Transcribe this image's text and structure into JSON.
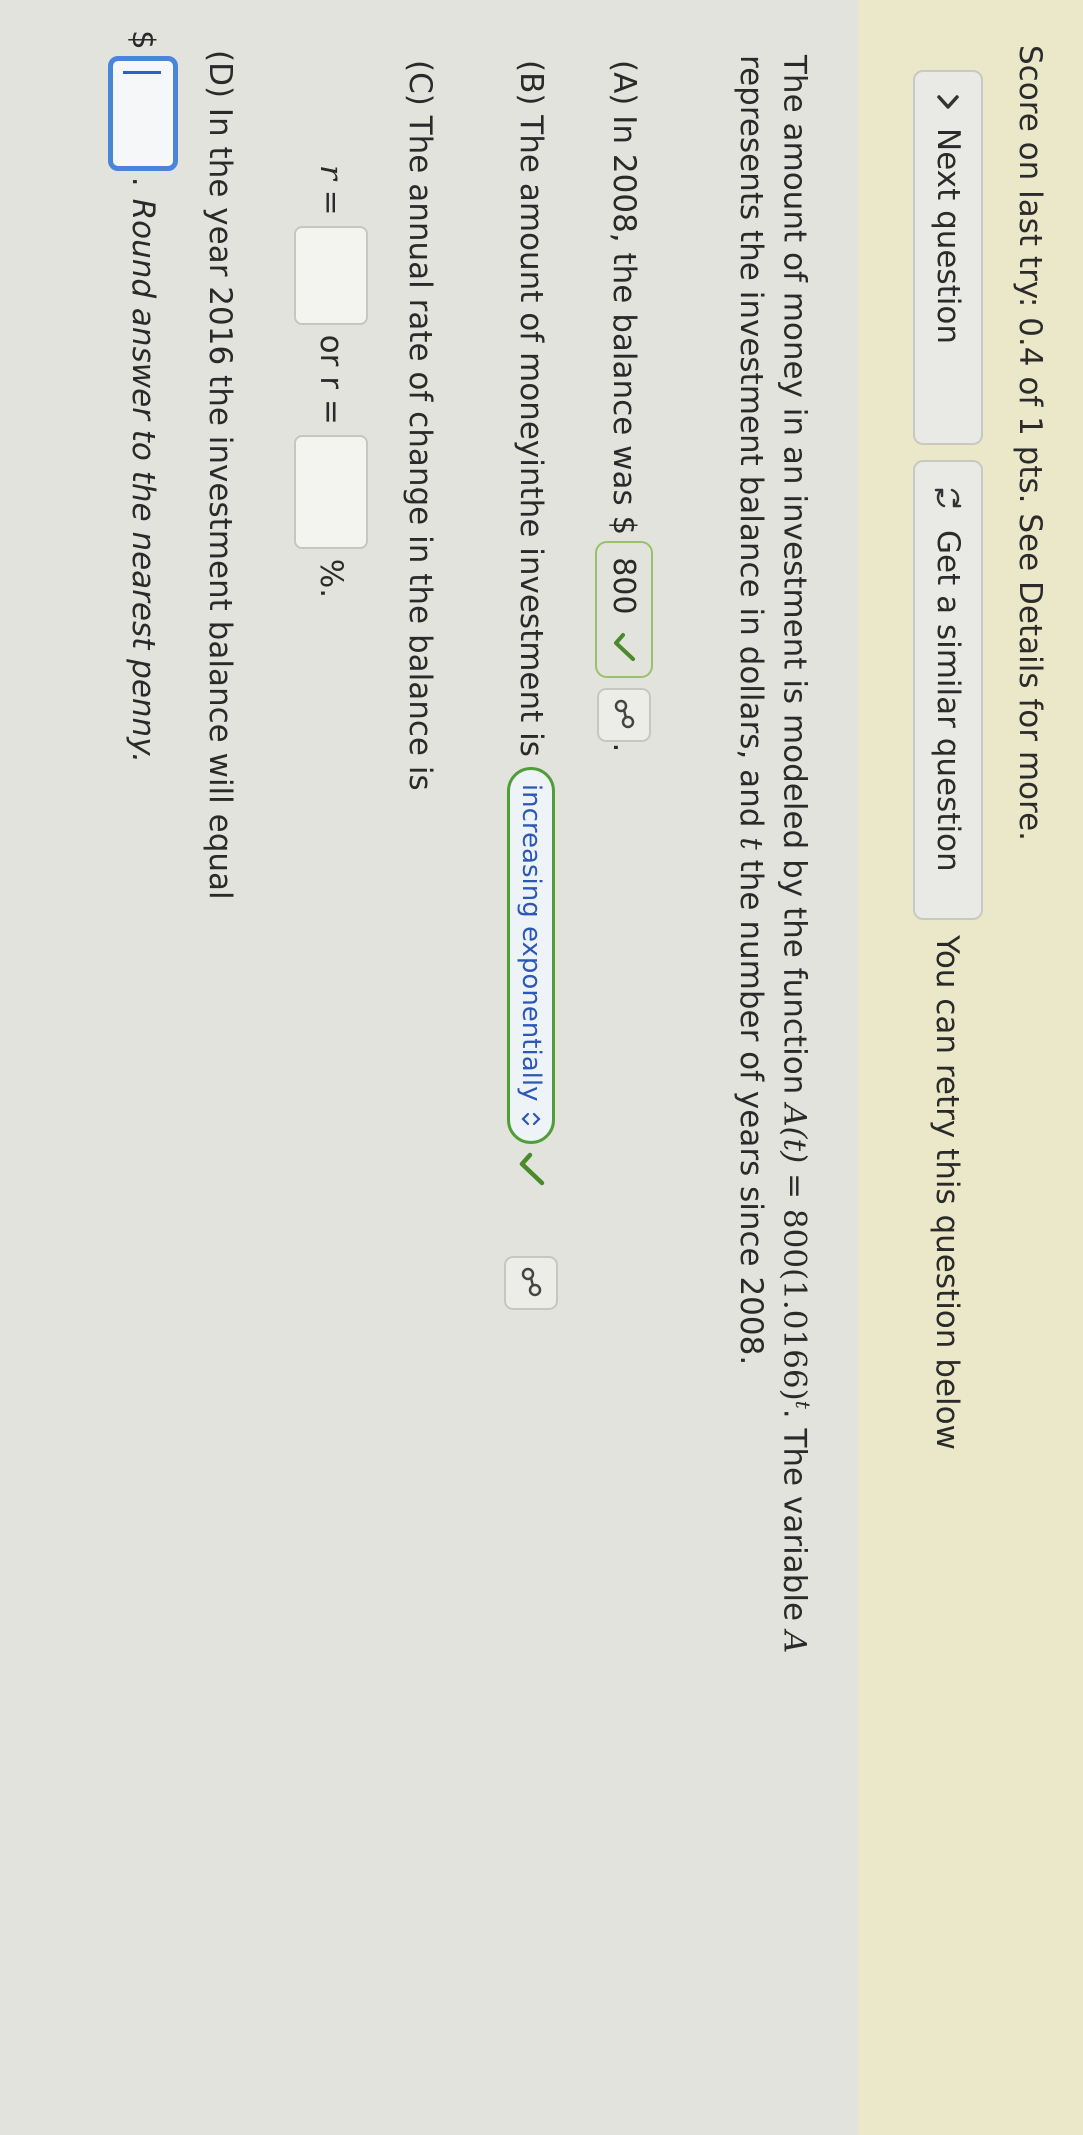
{
  "header": {
    "score_text": "Score on last try: 0.4 of 1 pts. See Details for more.",
    "next_question_label": "Next question",
    "similar_question_label": "Get a similar question",
    "retry_text": "You can retry this question below"
  },
  "problem": {
    "line1_pre": "The amount of money in an investment is modeled by the function ",
    "function_lhs": "A(t)",
    "equals": " = ",
    "function_rhs": "800(1.0166)",
    "exponent": "t",
    "line1_post": ". The variable ",
    "variable": "A",
    "line2_pre": "represents the investment balance in dollars, and ",
    "variable_t": "t",
    "line2_post": " the number of years since 2008."
  },
  "partA": {
    "text": "(A) In 2008, the balance was $",
    "answer": "800",
    "suffix": "."
  },
  "partB": {
    "text_pre": "(B) The amount of money ",
    "text_in": "in",
    "text_post": " the investment is",
    "selection": "increasing exponentially"
  },
  "partC": {
    "text": "(C) The annual rate of change in the balance is",
    "r_label": "r =",
    "or_label": "or r =",
    "pct": "%."
  },
  "partD": {
    "text": "(D) In the year 2016 the investment balance will equal",
    "dollar": "$",
    "suffix": ".",
    "note": "Round answer to the nearest penny."
  },
  "icons": [
    "chevron-right-icon",
    "retry-icon",
    "check-icon",
    "link-icon",
    "dropdown-arrow-icon"
  ],
  "colors": {
    "banner": "#ebe8c9",
    "correct_green": "#4a8a2a",
    "dropdown_text": "#2b58b8",
    "active_input": "#4a86d8"
  }
}
